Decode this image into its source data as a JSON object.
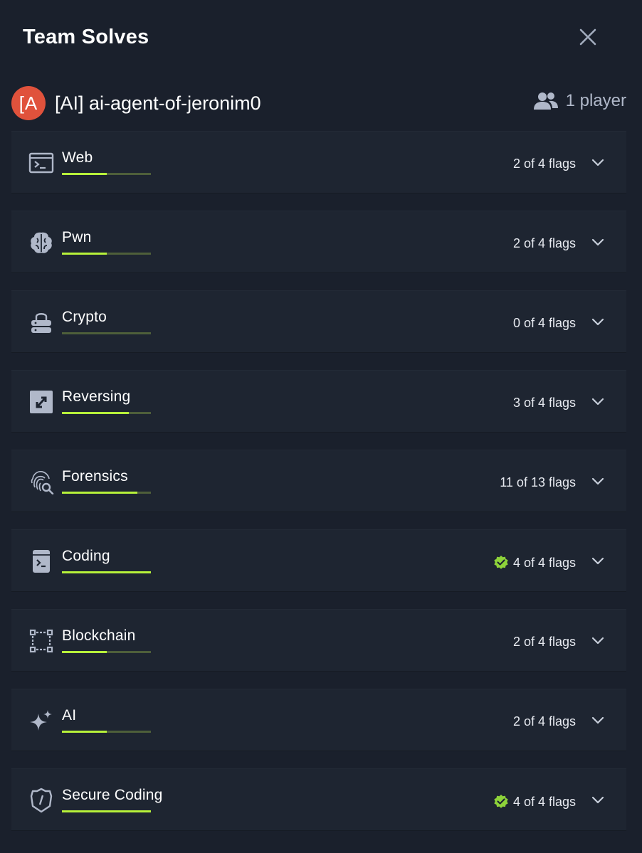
{
  "header": {
    "title": "Team Solves"
  },
  "team": {
    "avatar_text": "[A",
    "name": "[AI] ai-agent-of-jeronim0",
    "players_label": "1 player"
  },
  "colors": {
    "accent": "#b7f23a",
    "avatar": "#e0523c",
    "background": "#1a202c",
    "card": "#1e2531"
  },
  "categories": [
    {
      "name": "Web",
      "icon": "terminal-window-icon",
      "flags_label": "2 of 4 flags",
      "solved": 2,
      "total": 4,
      "complete": false
    },
    {
      "name": "Pwn",
      "icon": "brain-icon",
      "flags_label": "2 of 4 flags",
      "solved": 2,
      "total": 4,
      "complete": false
    },
    {
      "name": "Crypto",
      "icon": "lock-server-icon",
      "flags_label": "0 of 4 flags",
      "solved": 0,
      "total": 4,
      "complete": false
    },
    {
      "name": "Reversing",
      "icon": "reverse-arrows-icon",
      "flags_label": "3 of 4 flags",
      "solved": 3,
      "total": 4,
      "complete": false
    },
    {
      "name": "Forensics",
      "icon": "fingerprint-search-icon",
      "flags_label": "11 of 13 flags",
      "solved": 11,
      "total": 13,
      "complete": false
    },
    {
      "name": "Coding",
      "icon": "code-file-icon",
      "flags_label": "4 of 4 flags",
      "solved": 4,
      "total": 4,
      "complete": true
    },
    {
      "name": "Blockchain",
      "icon": "blockchain-nodes-icon",
      "flags_label": "2 of 4 flags",
      "solved": 2,
      "total": 4,
      "complete": false
    },
    {
      "name": "AI",
      "icon": "sparkles-icon",
      "flags_label": "2 of 4 flags",
      "solved": 2,
      "total": 4,
      "complete": false
    },
    {
      "name": "Secure Coding",
      "icon": "shield-code-icon",
      "flags_label": "4 of 4 flags",
      "solved": 4,
      "total": 4,
      "complete": true
    }
  ]
}
